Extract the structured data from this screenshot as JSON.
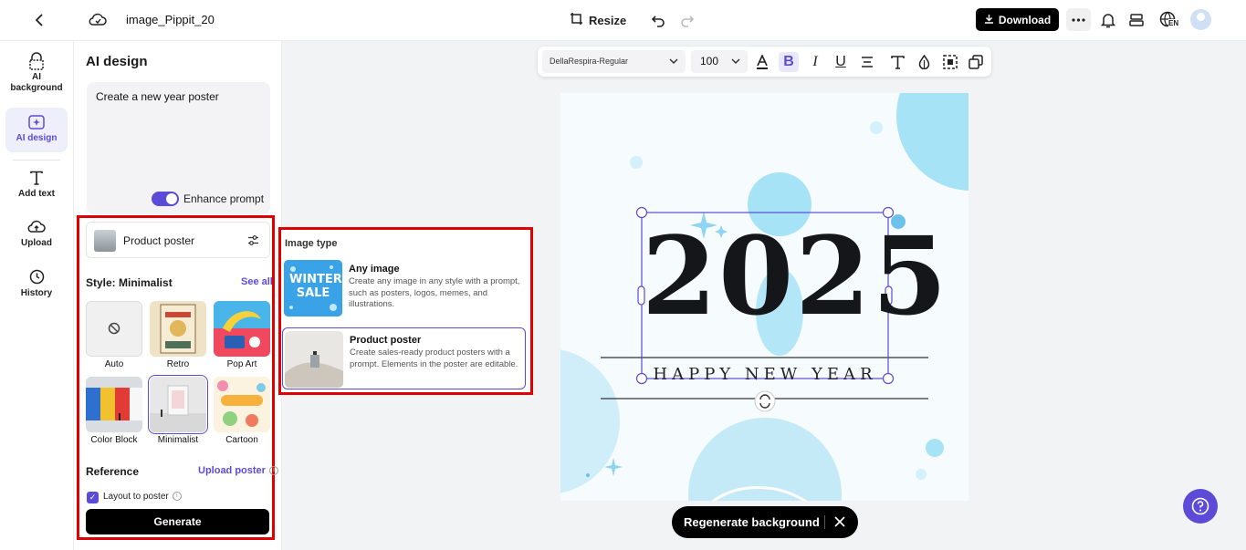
{
  "topbar": {
    "project_title": "image_Pippit_20",
    "resize_label": "Resize",
    "download_label": "Download",
    "lang_badge": "EN"
  },
  "rail": {
    "items": [
      {
        "label": "AI background"
      },
      {
        "label": "AI design"
      },
      {
        "label": "Add text"
      },
      {
        "label": "Upload"
      },
      {
        "label": "History"
      }
    ]
  },
  "panel": {
    "title": "AI design",
    "prompt_text": "Create a new year poster",
    "enhance_label": "Enhance prompt",
    "product_type": "Product poster",
    "style_label": "Style: Minimalist",
    "see_all": "See all",
    "styles": [
      {
        "name": "Auto"
      },
      {
        "name": "Retro"
      },
      {
        "name": "Pop Art"
      },
      {
        "name": "Color Block"
      },
      {
        "name": "Minimalist"
      },
      {
        "name": "Cartoon"
      }
    ],
    "reference_label": "Reference",
    "upload_poster": "Upload poster",
    "layout_label": "Layout to poster",
    "generate_label": "Generate"
  },
  "popup": {
    "title": "Image type",
    "options": [
      {
        "title": "Any image",
        "desc": "Create any image in any style with a prompt, such as posters, logos, memes, and illustrations.",
        "thumb_text": "WINTER SALE"
      },
      {
        "title": "Product poster",
        "desc": "Create sales-ready product posters with a prompt. Elements in the poster are editable."
      }
    ]
  },
  "toolbar": {
    "font": "DellaRespira-Regular",
    "size": "100"
  },
  "canvas": {
    "year": "2025",
    "subtitle": "HAPPY NEW YEAR"
  },
  "regenerate_label": "Regenerate background",
  "colors": {
    "accent": "#5b4bd6",
    "highlight": "#e00000",
    "canvas_blue": "#a7e3f6"
  }
}
